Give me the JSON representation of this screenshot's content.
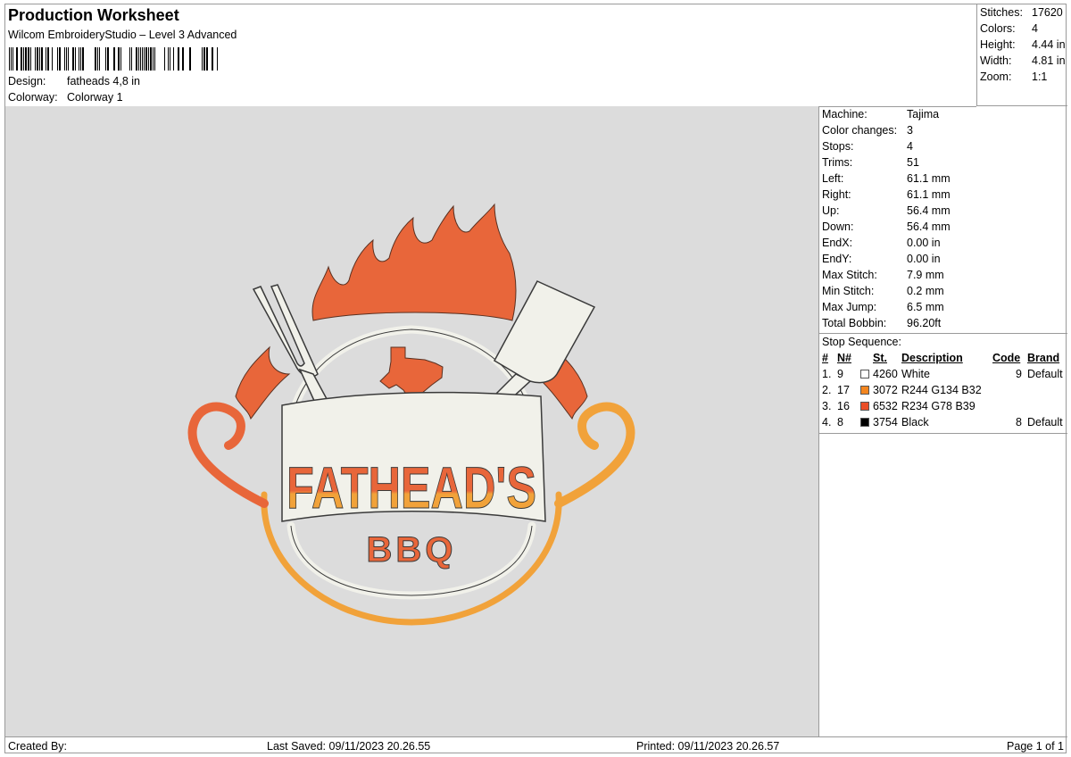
{
  "header": {
    "title": "Production Worksheet",
    "software": "Wilcom EmbroideryStudio – Level 3 Advanced",
    "design_label": "Design:",
    "design_value": "fatheads 4,8 in",
    "colorway_label": "Colorway:",
    "colorway_value": "Colorway 1"
  },
  "stats": [
    {
      "label": "Stitches:",
      "value": "17620"
    },
    {
      "label": "Colors:",
      "value": "4"
    },
    {
      "label": "Height:",
      "value": "4.44 in"
    },
    {
      "label": "Width:",
      "value": "4.81 in"
    },
    {
      "label": "Zoom:",
      "value": "1:1"
    }
  ],
  "machine": [
    {
      "label": "Machine:",
      "value": "Tajima"
    },
    {
      "label": "Color changes:",
      "value": "3"
    },
    {
      "label": "Stops:",
      "value": "4"
    },
    {
      "label": "Trims:",
      "value": "51"
    },
    {
      "label": "Left:",
      "value": "61.1 mm"
    },
    {
      "label": "Right:",
      "value": "61.1 mm"
    },
    {
      "label": "Up:",
      "value": "56.4 mm"
    },
    {
      "label": "Down:",
      "value": "56.4 mm"
    },
    {
      "label": "EndX:",
      "value": "0.00 in"
    },
    {
      "label": "EndY:",
      "value": "0.00 in"
    },
    {
      "label": "Max Stitch:",
      "value": "7.9 mm"
    },
    {
      "label": "Min Stitch:",
      "value": "0.2 mm"
    },
    {
      "label": "Max Jump:",
      "value": "6.5 mm"
    },
    {
      "label": "Total Bobbin:",
      "value": "96.20ft"
    }
  ],
  "stop_sequence": {
    "heading": "Stop Sequence:",
    "columns": [
      "#",
      "N#",
      "St.",
      "Description",
      "Code",
      "Brand"
    ],
    "rows": [
      {
        "idx": "1.",
        "n": "9",
        "color": "#ffffff",
        "st": "4260",
        "desc": "White",
        "code": "9",
        "brand": "Default"
      },
      {
        "idx": "2.",
        "n": "17",
        "color": "#f48620",
        "st": "3072",
        "desc": "R244 G134 B32",
        "code": "",
        "brand": ""
      },
      {
        "idx": "3.",
        "n": "16",
        "color": "#ea4e27",
        "st": "6532",
        "desc": "R234 G78 B39",
        "code": "",
        "brand": ""
      },
      {
        "idx": "4.",
        "n": "8",
        "color": "#000000",
        "st": "3754",
        "desc": "Black",
        "code": "8",
        "brand": "Default"
      }
    ]
  },
  "artwork": {
    "line1": "FATHEAD'S",
    "line2": "BBQ",
    "colors": {
      "orange_red": "#e8663a",
      "orange": "#f1a23a",
      "white": "#f1f1ea",
      "outline": "#3a3a3a",
      "canvas": "#dcdcdc"
    }
  },
  "footer": {
    "created_by": "Created By:",
    "last_saved": "Last Saved: 09/11/2023 20.26.55",
    "printed": "Printed: 09/11/2023 20.26.57",
    "page": "Page 1 of 1"
  }
}
